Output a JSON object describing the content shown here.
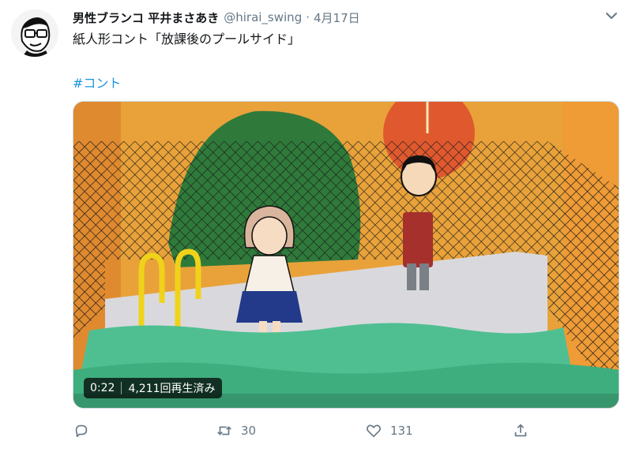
{
  "tweet": {
    "author_name": "男性ブランコ 平井まさあき",
    "handle": "@hirai_swing",
    "separator": "·",
    "date": "4月17日",
    "text": "紙人形コント「放課後のプールサイド」",
    "hashtag": "#コント"
  },
  "video": {
    "duration": "0:22",
    "views": "4,211回再生済み"
  },
  "actions": {
    "reply_icon": "reply-icon",
    "retweet_icon": "retweet-icon",
    "retweet_count": "30",
    "like_icon": "heart-icon",
    "like_count": "131",
    "share_icon": "share-icon"
  },
  "colors": {
    "link": "#1b95e0",
    "muted": "#657786",
    "background_orange": "#e9a23a",
    "pool_water": "#4fbf92",
    "hill_green": "#2f7a3a"
  }
}
